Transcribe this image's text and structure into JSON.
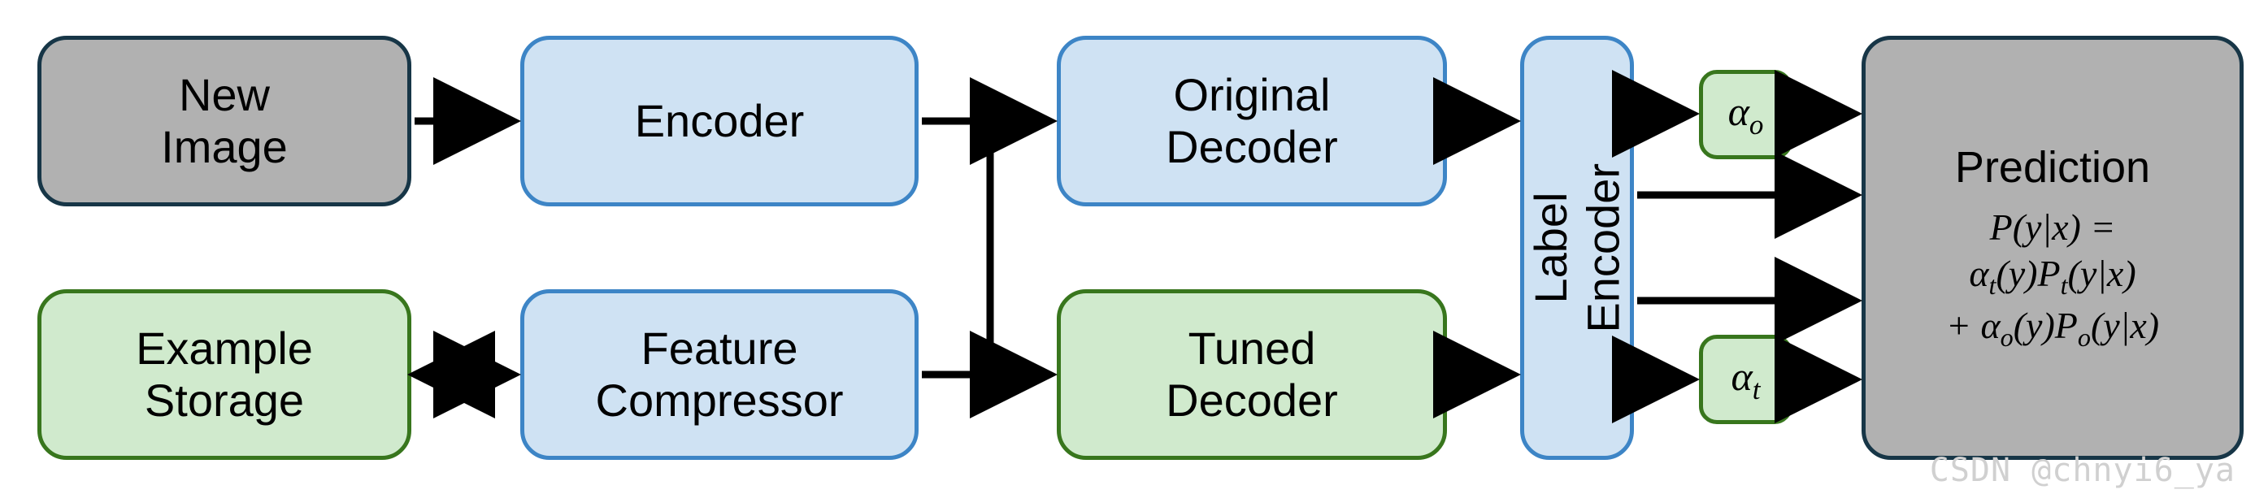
{
  "nodes": {
    "new_image": "New\nImage",
    "encoder": "Encoder",
    "example_storage": "Example\nStorage",
    "feature_compressor": "Feature\nCompressor",
    "original_decoder": "Original\nDecoder",
    "tuned_decoder": "Tuned\nDecoder",
    "label_encoder": "Label\nEncoder",
    "alpha_o_html": "α<span class='sub'>o</span>",
    "alpha_t_html": "α<span class='sub'>t</span>",
    "prediction_title": "Prediction",
    "prediction_eq1": "P(y|x) =",
    "prediction_eq2_html": "α<span class='sub'>t</span>(y)P<span class='sub'>t</span>(y|x)",
    "prediction_eq3_html": "+ α<span class='sub'>o</span>(y)P<span class='sub'>o</span>(y|x)"
  },
  "watermark": "CSDN @chnyi6_ya",
  "colors": {
    "gray_fill": "#b1b1b1",
    "gray_border": "#173647",
    "blue_fill": "#cfe2f3",
    "blue_border": "#3d85c6",
    "green_fill": "#d0eacd",
    "green_border": "#38761d"
  },
  "diagram_edges": [
    {
      "from": "new_image",
      "to": "encoder",
      "type": "uni"
    },
    {
      "from": "example_storage",
      "to": "feature_compressor",
      "type": "bi"
    },
    {
      "from": "encoder",
      "to": "original_decoder",
      "type": "uni"
    },
    {
      "from": "encoder",
      "to": "tuned_decoder",
      "type": "uni_via_feature_compressor_out"
    },
    {
      "from": "feature_compressor",
      "to": "original_decoder",
      "type": "uni"
    },
    {
      "from": "feature_compressor",
      "to": "tuned_decoder",
      "type": "uni"
    },
    {
      "from": "original_decoder",
      "to": "label_encoder",
      "type": "uni"
    },
    {
      "from": "tuned_decoder",
      "to": "label_encoder",
      "type": "uni"
    },
    {
      "from": "label_encoder",
      "to": "alpha_o",
      "type": "uni"
    },
    {
      "from": "label_encoder",
      "to": "alpha_t",
      "type": "uni"
    },
    {
      "from": "label_encoder",
      "to": "prediction",
      "type": "uni"
    },
    {
      "from": "label_encoder",
      "to": "prediction",
      "type": "uni"
    },
    {
      "from": "alpha_o",
      "to": "prediction",
      "type": "uni"
    },
    {
      "from": "alpha_t",
      "to": "prediction",
      "type": "uni"
    }
  ]
}
